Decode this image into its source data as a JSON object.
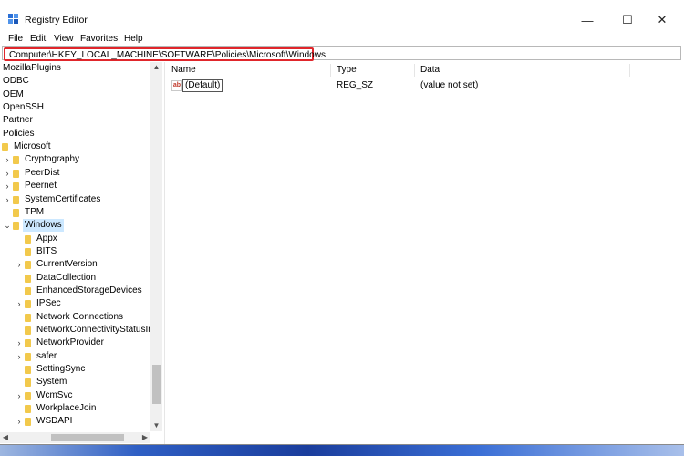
{
  "window": {
    "title": "Registry Editor",
    "controls": {
      "minimize": "—",
      "maximize": "☐",
      "close": "✕"
    }
  },
  "menu": [
    "File",
    "Edit",
    "View",
    "Favorites",
    "Help"
  ],
  "address": {
    "path": "Computer\\HKEY_LOCAL_MACHINE\\SOFTWARE\\Policies\\Microsoft\\Windows"
  },
  "tree": [
    {
      "label": "MozillaPlugins",
      "chevron": ""
    },
    {
      "label": "ODBC",
      "chevron": ""
    },
    {
      "label": "OEM",
      "chevron": ""
    },
    {
      "label": "OpenSSH",
      "chevron": ""
    },
    {
      "label": "Partner",
      "chevron": ""
    },
    {
      "label": "Policies",
      "chevron": ""
    },
    {
      "label": "Microsoft",
      "chevron": ""
    },
    {
      "label": "Cryptography",
      "chevron": "›"
    },
    {
      "label": "PeerDist",
      "chevron": "›"
    },
    {
      "label": "Peernet",
      "chevron": "›"
    },
    {
      "label": "SystemCertificates",
      "chevron": "›"
    },
    {
      "label": "TPM",
      "chevron": ""
    },
    {
      "label": "Windows",
      "chevron": "⌄",
      "selected": true
    },
    {
      "label": "Appx",
      "chevron": ""
    },
    {
      "label": "BITS",
      "chevron": ""
    },
    {
      "label": "CurrentVersion",
      "chevron": "›"
    },
    {
      "label": "DataCollection",
      "chevron": ""
    },
    {
      "label": "EnhancedStorageDevices",
      "chevron": ""
    },
    {
      "label": "IPSec",
      "chevron": "›"
    },
    {
      "label": "Network Connections",
      "chevron": ""
    },
    {
      "label": "NetworkConnectivityStatusIn",
      "chevron": ""
    },
    {
      "label": "NetworkProvider",
      "chevron": "›"
    },
    {
      "label": "safer",
      "chevron": "›"
    },
    {
      "label": "SettingSync",
      "chevron": ""
    },
    {
      "label": "System",
      "chevron": ""
    },
    {
      "label": "WcmSvc",
      "chevron": "›"
    },
    {
      "label": "WorkplaceJoin",
      "chevron": ""
    },
    {
      "label": "WSDAPI",
      "chevron": "›"
    }
  ],
  "columns": {
    "name": "Name",
    "type": "Type",
    "data": "Data"
  },
  "values": [
    {
      "name": "(Default)",
      "type": "REG_SZ",
      "data": "(value not set)",
      "icon": "ab"
    }
  ],
  "colors": {
    "address_highlight": "#e0262b",
    "folder": "#f2c94c",
    "selection": "#cce8ff"
  }
}
